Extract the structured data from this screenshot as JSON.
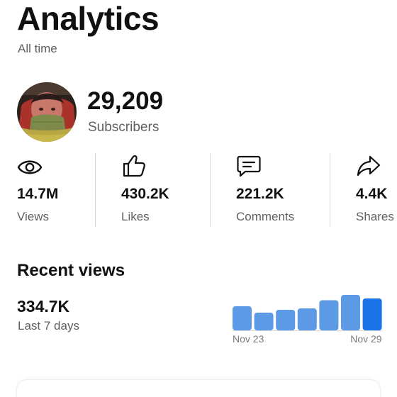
{
  "header": {
    "title": "Analytics",
    "period": "All time"
  },
  "profile": {
    "subscriber_count": "29,209",
    "subscriber_label": "Subscribers"
  },
  "stats": [
    {
      "icon": "eye-icon",
      "value": "14.7M",
      "label": "Views"
    },
    {
      "icon": "thumbs-up-icon",
      "value": "430.2K",
      "label": "Likes"
    },
    {
      "icon": "comment-icon",
      "value": "221.2K",
      "label": "Comments"
    },
    {
      "icon": "share-icon",
      "value": "4.4K",
      "label": "Shares"
    }
  ],
  "recent": {
    "title": "Recent views",
    "value": "334.7K",
    "period_label": "Last 7 days"
  },
  "chart_data": {
    "type": "bar",
    "x_labels": [
      "Nov 23",
      "Nov 29"
    ],
    "values": [
      0.68,
      0.5,
      0.58,
      0.62,
      0.85,
      1.0,
      0.9
    ],
    "colors": {
      "bar": "#5d9ae6",
      "bar_latest": "#1a73e8",
      "label": "#7a7a7a",
      "axis": "#d8d8d8"
    },
    "grid": false,
    "legend": "none"
  },
  "colors": {
    "text": "#111111",
    "muted": "#5f5f5f",
    "divider": "#dadada"
  }
}
